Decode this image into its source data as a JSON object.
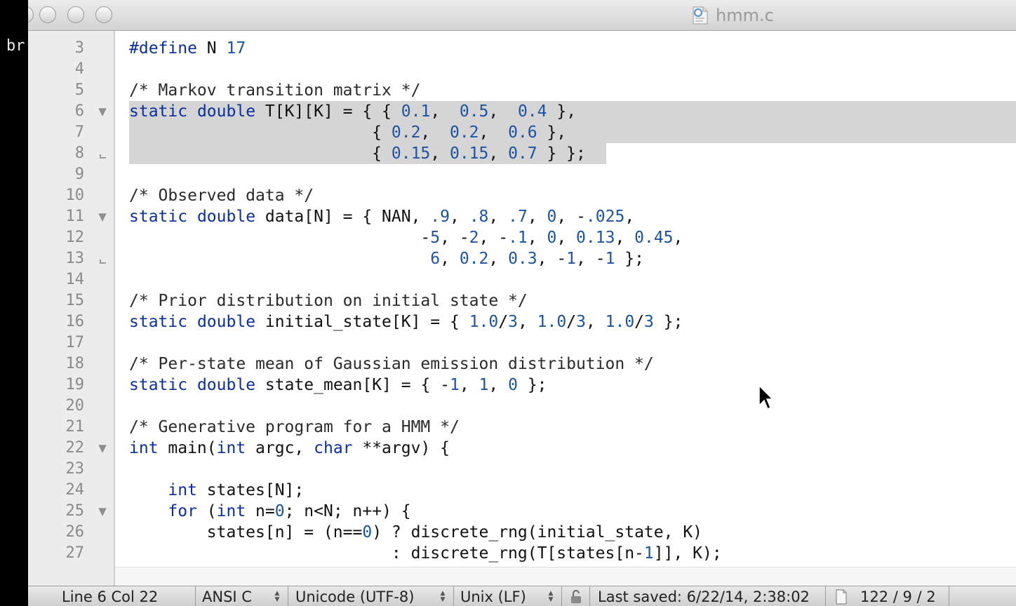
{
  "terminal": {
    "partial_text": "br"
  },
  "window": {
    "title": "hmm.c",
    "title_icon": "c-source-file-icon"
  },
  "code": {
    "lines": [
      {
        "n": "3",
        "fold": "",
        "segs": [
          [
            "kw",
            "#define"
          ],
          [
            "t",
            " N "
          ],
          [
            "num",
            "17"
          ]
        ]
      },
      {
        "n": "4",
        "fold": "",
        "segs": []
      },
      {
        "n": "5",
        "fold": "",
        "segs": [
          [
            "cm",
            "/* Markov transition matrix */"
          ]
        ]
      },
      {
        "n": "6",
        "fold": "start",
        "segs": [
          [
            "kw",
            "static"
          ],
          [
            "t",
            " "
          ],
          [
            "kw",
            "double"
          ],
          [
            "t",
            " T[K][K] = { { "
          ],
          [
            "num",
            "0.1"
          ],
          [
            "t",
            ",  "
          ],
          [
            "num",
            "0.5"
          ],
          [
            "t",
            ",  "
          ],
          [
            "num",
            "0.4"
          ],
          [
            "t",
            " },"
          ]
        ]
      },
      {
        "n": "7",
        "fold": "",
        "segs": [
          [
            "t",
            "                         { "
          ],
          [
            "num",
            "0.2"
          ],
          [
            "t",
            ",  "
          ],
          [
            "num",
            "0.2"
          ],
          [
            "t",
            ",  "
          ],
          [
            "num",
            "0.6"
          ],
          [
            "t",
            " },"
          ]
        ]
      },
      {
        "n": "8",
        "fold": "end",
        "segs": [
          [
            "t",
            "                         { "
          ],
          [
            "num",
            "0.15"
          ],
          [
            "t",
            ", "
          ],
          [
            "num",
            "0.15"
          ],
          [
            "t",
            ", "
          ],
          [
            "num",
            "0.7"
          ],
          [
            "t",
            " } };"
          ]
        ]
      },
      {
        "n": "9",
        "fold": "",
        "segs": []
      },
      {
        "n": "10",
        "fold": "",
        "segs": [
          [
            "cm",
            "/* Observed data */"
          ]
        ]
      },
      {
        "n": "11",
        "fold": "start",
        "segs": [
          [
            "kw",
            "static"
          ],
          [
            "t",
            " "
          ],
          [
            "kw",
            "double"
          ],
          [
            "t",
            " data[N] = { NAN, "
          ],
          [
            "num",
            ".9"
          ],
          [
            "t",
            ", "
          ],
          [
            "num",
            ".8"
          ],
          [
            "t",
            ", "
          ],
          [
            "num",
            ".7"
          ],
          [
            "t",
            ", "
          ],
          [
            "num",
            "0"
          ],
          [
            "t",
            ", -"
          ],
          [
            "num",
            ".025"
          ],
          [
            "t",
            ","
          ]
        ]
      },
      {
        "n": "12",
        "fold": "",
        "segs": [
          [
            "t",
            "                              -"
          ],
          [
            "num",
            "5"
          ],
          [
            "t",
            ", -"
          ],
          [
            "num",
            "2"
          ],
          [
            "t",
            ", -"
          ],
          [
            "num",
            ".1"
          ],
          [
            "t",
            ", "
          ],
          [
            "num",
            "0"
          ],
          [
            "t",
            ", "
          ],
          [
            "num",
            "0.13"
          ],
          [
            "t",
            ", "
          ],
          [
            "num",
            "0.45"
          ],
          [
            "t",
            ","
          ]
        ]
      },
      {
        "n": "13",
        "fold": "end",
        "segs": [
          [
            "t",
            "                               "
          ],
          [
            "num",
            "6"
          ],
          [
            "t",
            ", "
          ],
          [
            "num",
            "0.2"
          ],
          [
            "t",
            ", "
          ],
          [
            "num",
            "0.3"
          ],
          [
            "t",
            ", -"
          ],
          [
            "num",
            "1"
          ],
          [
            "t",
            ", -"
          ],
          [
            "num",
            "1"
          ],
          [
            "t",
            " };"
          ]
        ]
      },
      {
        "n": "14",
        "fold": "",
        "segs": []
      },
      {
        "n": "15",
        "fold": "",
        "segs": [
          [
            "cm",
            "/* Prior distribution on initial state */"
          ]
        ]
      },
      {
        "n": "16",
        "fold": "",
        "segs": [
          [
            "kw",
            "static"
          ],
          [
            "t",
            " "
          ],
          [
            "kw",
            "double"
          ],
          [
            "t",
            " initial_state[K] = { "
          ],
          [
            "num",
            "1.0"
          ],
          [
            "t",
            "/"
          ],
          [
            "num",
            "3"
          ],
          [
            "t",
            ", "
          ],
          [
            "num",
            "1.0"
          ],
          [
            "t",
            "/"
          ],
          [
            "num",
            "3"
          ],
          [
            "t",
            ", "
          ],
          [
            "num",
            "1.0"
          ],
          [
            "t",
            "/"
          ],
          [
            "num",
            "3"
          ],
          [
            "t",
            " };"
          ]
        ]
      },
      {
        "n": "17",
        "fold": "",
        "segs": []
      },
      {
        "n": "18",
        "fold": "",
        "segs": [
          [
            "cm",
            "/* Per-state mean of Gaussian emission distribution */"
          ]
        ]
      },
      {
        "n": "19",
        "fold": "",
        "segs": [
          [
            "kw",
            "static"
          ],
          [
            "t",
            " "
          ],
          [
            "kw",
            "double"
          ],
          [
            "t",
            " state_mean[K] = { -"
          ],
          [
            "num",
            "1"
          ],
          [
            "t",
            ", "
          ],
          [
            "num",
            "1"
          ],
          [
            "t",
            ", "
          ],
          [
            "num",
            "0"
          ],
          [
            "t",
            " };"
          ]
        ]
      },
      {
        "n": "20",
        "fold": "",
        "segs": []
      },
      {
        "n": "21",
        "fold": "",
        "segs": [
          [
            "cm",
            "/* Generative program for a HMM */"
          ]
        ]
      },
      {
        "n": "22",
        "fold": "start",
        "segs": [
          [
            "kw",
            "int"
          ],
          [
            "t",
            " main("
          ],
          [
            "kw",
            "int"
          ],
          [
            "t",
            " argc, "
          ],
          [
            "kw",
            "char"
          ],
          [
            "t",
            " **argv) {"
          ]
        ]
      },
      {
        "n": "23",
        "fold": "",
        "segs": []
      },
      {
        "n": "24",
        "fold": "",
        "segs": [
          [
            "t",
            "    "
          ],
          [
            "kw",
            "int"
          ],
          [
            "t",
            " states[N];"
          ]
        ]
      },
      {
        "n": "25",
        "fold": "start",
        "segs": [
          [
            "t",
            "    "
          ],
          [
            "kw",
            "for"
          ],
          [
            "t",
            " ("
          ],
          [
            "kw",
            "int"
          ],
          [
            "t",
            " n="
          ],
          [
            "num",
            "0"
          ],
          [
            "t",
            "; n<N; n++) {"
          ]
        ]
      },
      {
        "n": "26",
        "fold": "",
        "segs": [
          [
            "t",
            "        states[n] = (n=="
          ],
          [
            "num",
            "0"
          ],
          [
            "t",
            ") ? discrete_rng(initial_state, K)"
          ]
        ]
      },
      {
        "n": "27",
        "fold": "",
        "segs": [
          [
            "t",
            "                           : discrete_rng(T[states[n-"
          ],
          [
            "num",
            "1"
          ],
          [
            "t",
            "]], K);"
          ]
        ]
      }
    ]
  },
  "statusbar": {
    "position": "Line 6 Col 22",
    "language": "ANSI C",
    "encoding": "Unicode (UTF-8)",
    "line_endings": "Unix (LF)",
    "lock_icon": "lock-icon",
    "last_saved": "Last saved: 6/22/14, 2:38:02",
    "doc_icon": "document-icon",
    "counts": "122 / 9 / 2"
  },
  "colors": {
    "keyword": "#0b2f9e",
    "number": "#1c54a2",
    "selection": "#d5d5d5",
    "gutter": "#ececec"
  }
}
